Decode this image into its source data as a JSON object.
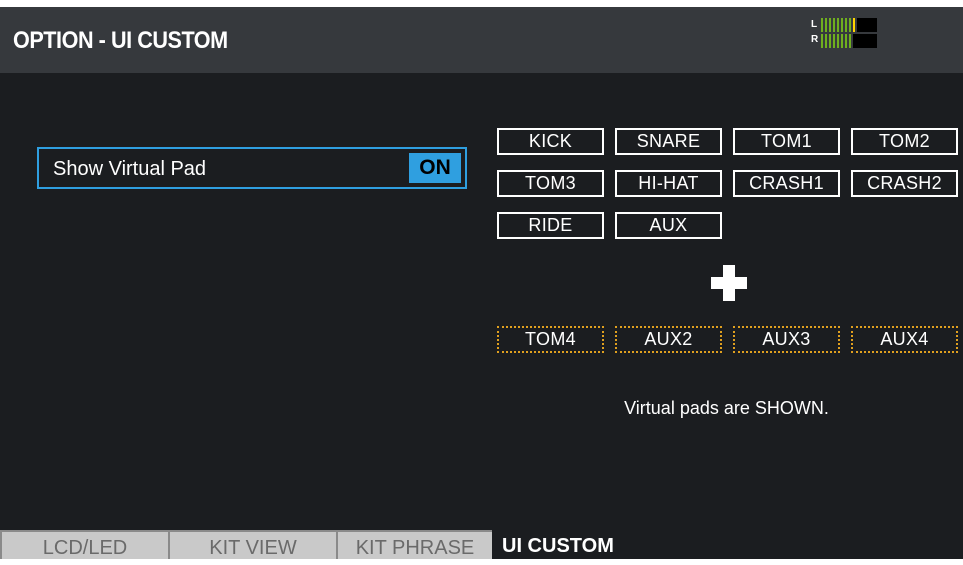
{
  "header": {
    "title": "OPTION - UI CUSTOM",
    "meter": {
      "left_label": "L",
      "right_label": "R",
      "left_level": 0.72,
      "right_level": 0.6
    }
  },
  "option": {
    "label": "Show Virtual Pad",
    "value": "ON"
  },
  "pads": {
    "standard": [
      "KICK",
      "SNARE",
      "TOM1",
      "TOM2",
      "TOM3",
      "HI-HAT",
      "CRASH1",
      "CRASH2",
      "RIDE",
      "AUX"
    ],
    "extra": [
      "TOM4",
      "AUX2",
      "AUX3",
      "AUX4"
    ],
    "plus_symbol": "+"
  },
  "status": "Virtual pads are SHOWN.",
  "tabs": [
    {
      "label": "LCD/LED",
      "active": false
    },
    {
      "label": "KIT VIEW",
      "active": false
    },
    {
      "label": "KIT PHRASE",
      "active": false
    },
    {
      "label": "UI CUSTOM",
      "active": true
    }
  ],
  "colors": {
    "background": "#1b1d20",
    "title_bar": "#36393d",
    "accent": "#2f9fe0",
    "extra_pad_border": "#e0a01f",
    "meter_green": "#6fae1f",
    "meter_peak": "#ffd400",
    "tab_inactive": "#c9c9c9"
  }
}
